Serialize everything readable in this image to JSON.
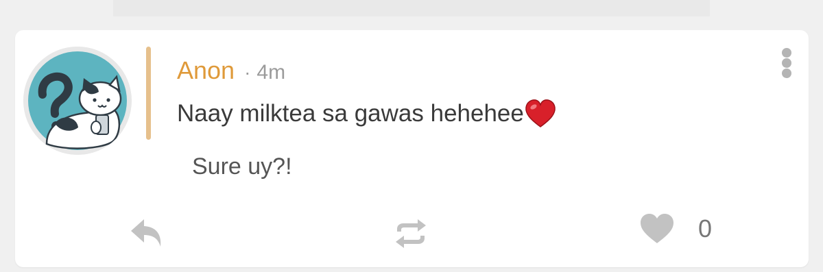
{
  "post": {
    "author": "Anon",
    "separator": "·",
    "time": "4m",
    "message": "Naay milktea sa gawas hehehee",
    "reply_preview": "Sure uy?!",
    "like_count": "0"
  },
  "icons": {
    "avatar": "cat-with-phone-avatar",
    "emoji": "red-heart-emoji",
    "more": "vertical-ellipsis-icon",
    "reply": "reply-arrow-icon",
    "repost": "repost-icon",
    "like": "heart-icon"
  },
  "colors": {
    "author": "#df9a3a",
    "quote_bar": "#e6c08c",
    "avatar_bg": "#5db4c0",
    "icon_gray": "#c2c2c2"
  }
}
